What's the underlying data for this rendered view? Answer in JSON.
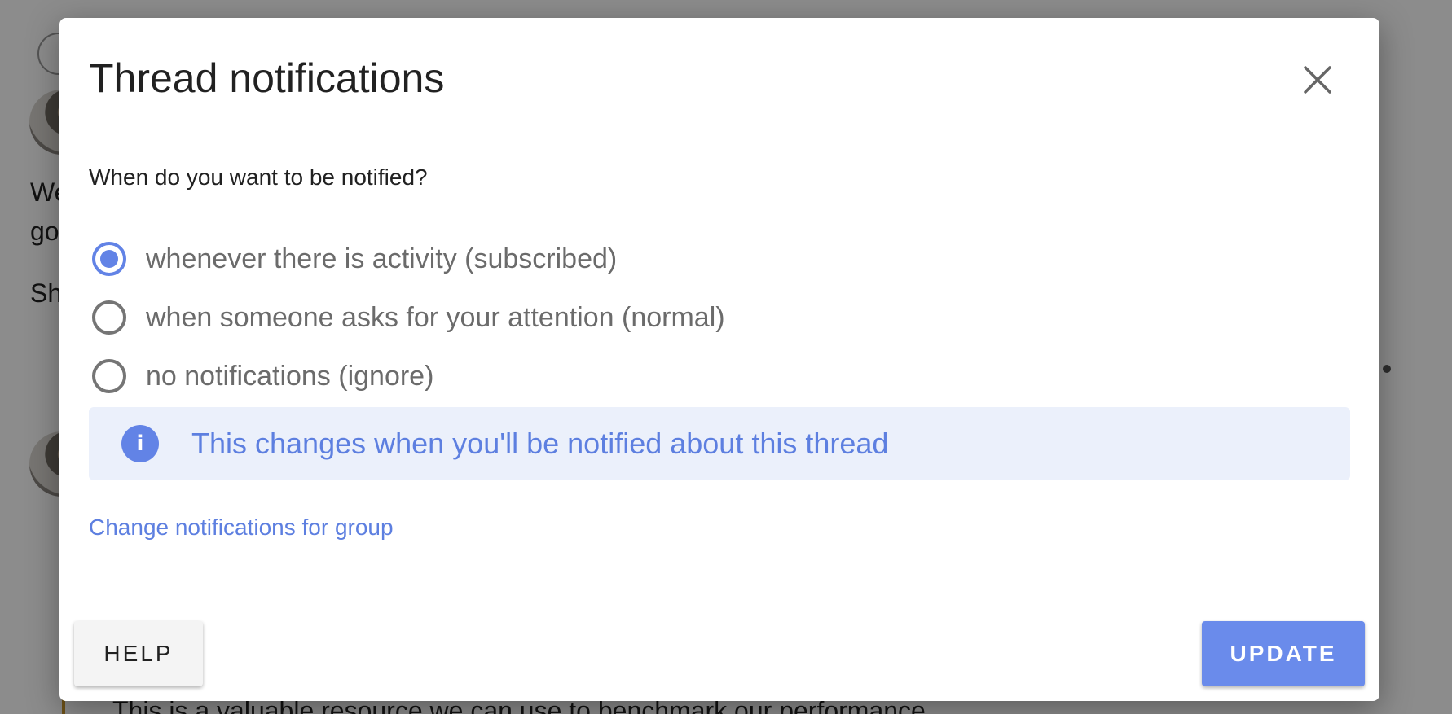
{
  "background": {
    "snippets": [
      "We",
      "go",
      "Sh",
      "This is a valuable resource we can use to benchmark our performance"
    ]
  },
  "dialog": {
    "title": "Thread notifications",
    "close_icon": "close-icon",
    "question": "When do you want to be notified?",
    "options": [
      {
        "label": "whenever there is activity (subscribed)",
        "checked": true
      },
      {
        "label": "when someone asks for your attention (normal)",
        "checked": false
      },
      {
        "label": "no notifications (ignore)",
        "checked": false
      }
    ],
    "info": {
      "icon": "info-icon",
      "icon_glyph": "i",
      "text": "This changes when you'll be notified about this thread"
    },
    "group_link": "Change notifications for group",
    "help_label": "HELP",
    "update_label": "UPDATE"
  },
  "colors": {
    "accent": "#6283e6",
    "info_bg": "#ebf0fb",
    "update_bg": "#6a8beb"
  }
}
